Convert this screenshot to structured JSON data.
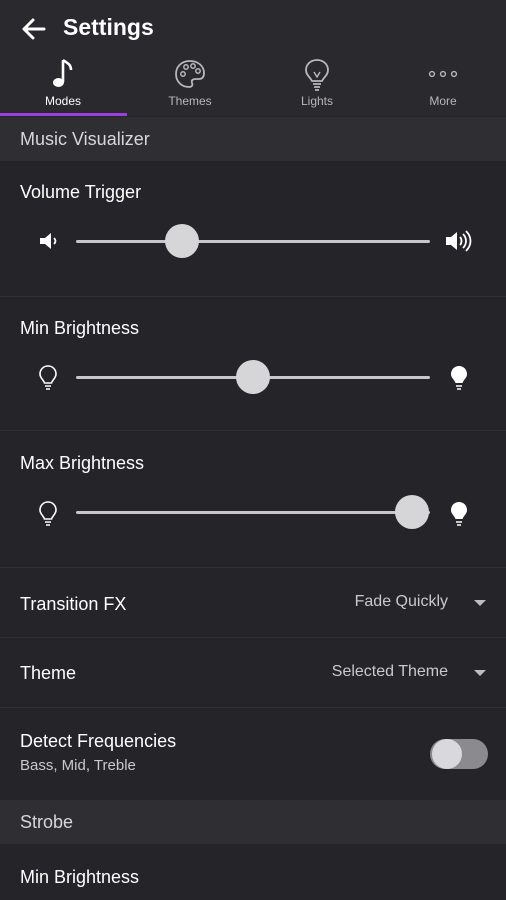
{
  "header": {
    "title": "Settings",
    "back_icon": "arrow-left-icon"
  },
  "tabs": [
    {
      "label": "Modes",
      "icon": "music-note-icon",
      "active": true
    },
    {
      "label": "Themes",
      "icon": "palette-icon",
      "active": false
    },
    {
      "label": "Lights",
      "icon": "lightbulb-icon",
      "active": false
    },
    {
      "label": "More",
      "icon": "more-dots-icon",
      "active": false
    }
  ],
  "colors": {
    "accent": "#9b3fe0",
    "background": "#242429",
    "section_header": "#2e2e33"
  },
  "music_visualizer": {
    "section_title": "Music Visualizer",
    "volume_trigger": {
      "label": "Volume Trigger",
      "value": 0.3
    },
    "min_brightness": {
      "label": "Min Brightness",
      "value": 0.5
    },
    "max_brightness": {
      "label": "Max Brightness",
      "value": 0.95
    },
    "transition_fx": {
      "label": "Transition FX",
      "value": "Fade Quickly"
    },
    "theme": {
      "label": "Theme",
      "value": "Selected Theme"
    },
    "detect_frequencies": {
      "label": "Detect Frequencies",
      "subtitle": "Bass, Mid, Treble",
      "enabled": false
    }
  },
  "strobe": {
    "section_title": "Strobe",
    "min_brightness": {
      "label": "Min Brightness"
    }
  }
}
